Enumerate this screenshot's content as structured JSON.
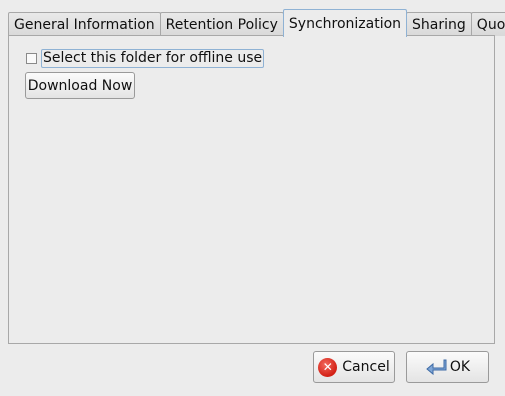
{
  "tabs": [
    {
      "label": "General Information",
      "active": false
    },
    {
      "label": "Retention Policy",
      "active": false
    },
    {
      "label": "Synchronization",
      "active": true
    },
    {
      "label": "Sharing",
      "active": false
    },
    {
      "label": "Quota",
      "active": false
    }
  ],
  "sync": {
    "offline_checkbox_label": "Select this folder for offline use",
    "offline_checked": false,
    "download_label": "Download Now"
  },
  "footer": {
    "cancel_label": "Cancel",
    "ok_label": "OK"
  },
  "colors": {
    "background": "#ececec",
    "cancel_icon": "#d21f14",
    "focus_border": "#8fb2d4"
  },
  "icons": {
    "cancel": "cancel-icon",
    "ok": "ok-arrow-icon"
  }
}
